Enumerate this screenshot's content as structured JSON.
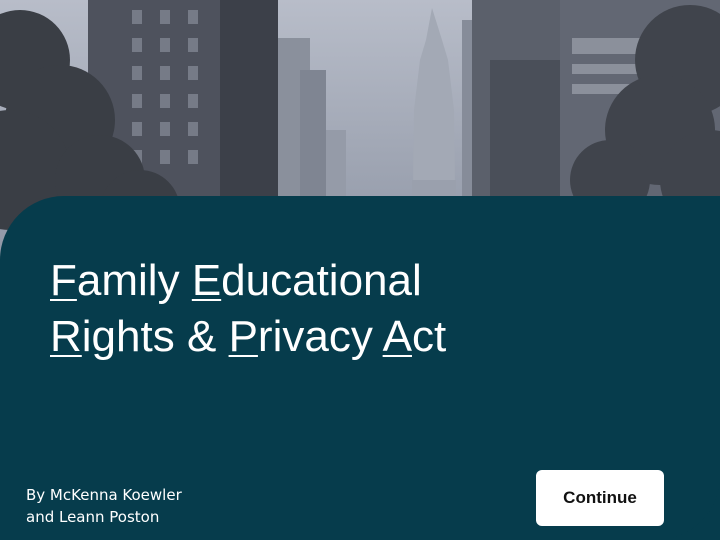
{
  "slide": {
    "background_color": "#063c4c",
    "photo": {
      "subject": "city-street-skyscrapers-image"
    },
    "title": {
      "line1": {
        "words": [
          {
            "ul": "F",
            "rest": "amily"
          },
          {
            "ul": "E",
            "rest": "ducational"
          }
        ]
      },
      "line2": {
        "words": [
          {
            "ul": "R",
            "rest": "ights"
          },
          {
            "ul": "",
            "rest": "&"
          },
          {
            "ul": "P",
            "rest": "rivacy"
          },
          {
            "ul": "A",
            "rest": "ct"
          }
        ]
      }
    },
    "byline": {
      "line1": "By McKenna Koewler",
      "line2": "and Leann Poston"
    },
    "continue_button": {
      "label": "Continue"
    }
  }
}
